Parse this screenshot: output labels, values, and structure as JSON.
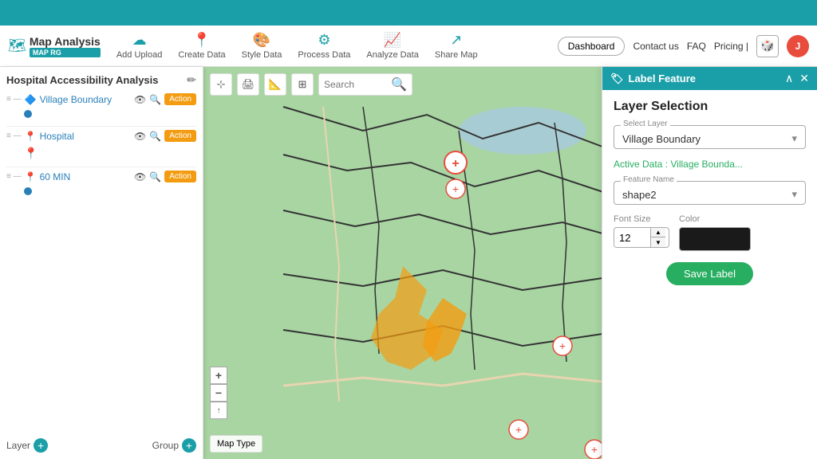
{
  "topbar": {
    "bg": "#1a9fa8"
  },
  "toolbar": {
    "logo_text": "Map Analysis",
    "logo_sub": "MAP RG",
    "items": [
      {
        "label": "Add Upload",
        "icon": "☁"
      },
      {
        "label": "Create Data",
        "icon": "📍"
      },
      {
        "label": "Style Data",
        "icon": "🎨"
      },
      {
        "label": "Process Data",
        "icon": "⚙"
      },
      {
        "label": "Analyze Data",
        "icon": "📈"
      },
      {
        "label": "Share Map",
        "icon": "↗"
      }
    ],
    "nav": [
      "Dashboard",
      "Contact us",
      "FAQ",
      "Pricing |"
    ],
    "avatar_initial": "J"
  },
  "left_panel": {
    "title": "Hospital Accessibility Analysis",
    "layers": [
      {
        "name": "Village Boundary",
        "icon": "🔷",
        "color": "blue"
      },
      {
        "name": "Hospital",
        "icon": "📍",
        "color": "default"
      },
      {
        "name": "60 MIN",
        "icon": "📍",
        "color": "default"
      }
    ],
    "layer_btn": "Layer",
    "group_btn": "Group"
  },
  "map": {
    "search_placeholder": "Search",
    "map_type_label": "Map Type"
  },
  "right_panel": {
    "header_title": "Label Feature",
    "section_title": "Layer Selection",
    "select_layer_label": "Select Layer",
    "select_layer_value": "Village Boundary",
    "active_data_label": "Active Data : Village Bounda...",
    "feature_name_label": "Feature Name",
    "feature_name_value": "shape2",
    "font_size_label": "Font Size",
    "font_size_value": "12",
    "color_label": "Color",
    "save_label_btn": "Save Label"
  }
}
